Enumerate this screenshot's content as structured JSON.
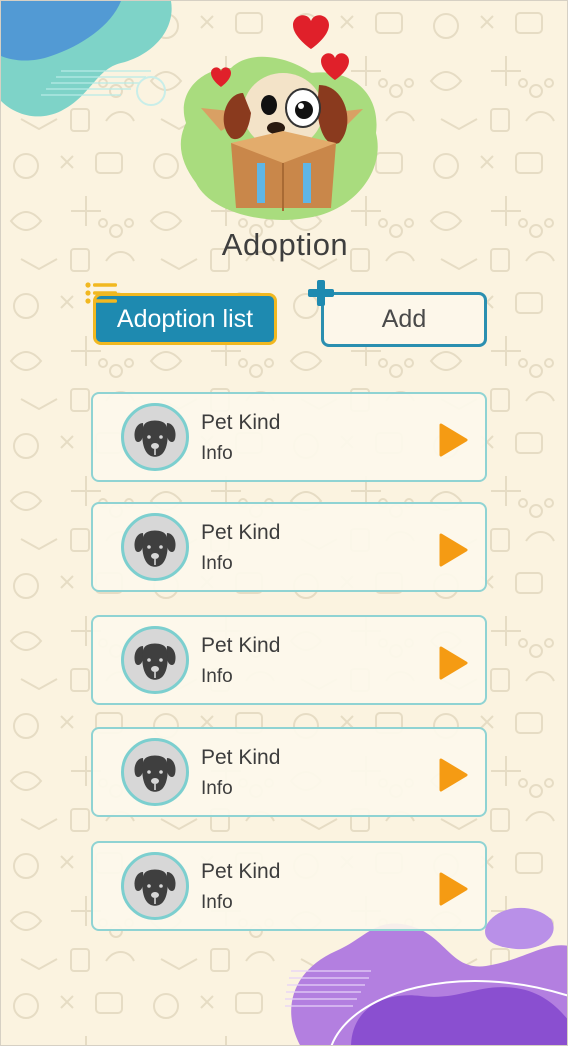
{
  "header": {
    "title": "Adoption"
  },
  "tabs": {
    "list_label": "Adoption list",
    "add_label": "Add"
  },
  "pets": [
    {
      "kind": "Pet Kind",
      "info": "Info"
    },
    {
      "kind": "Pet Kind",
      "info": "Info"
    },
    {
      "kind": "Pet Kind",
      "info": "Info"
    },
    {
      "kind": "Pet Kind",
      "info": "Info"
    },
    {
      "kind": "Pet Kind",
      "info": "Info"
    }
  ],
  "colors": {
    "background": "#fbf3e0",
    "primary": "#1e8ab0",
    "accent_yellow": "#f1b820",
    "arrow_orange": "#f59b13",
    "card_border": "#8fd3d3",
    "avatar_bg": "#d7d7d7"
  },
  "icons": [
    "list-icon",
    "plus-icon",
    "dog-avatar-icon",
    "play-arrow-icon"
  ]
}
